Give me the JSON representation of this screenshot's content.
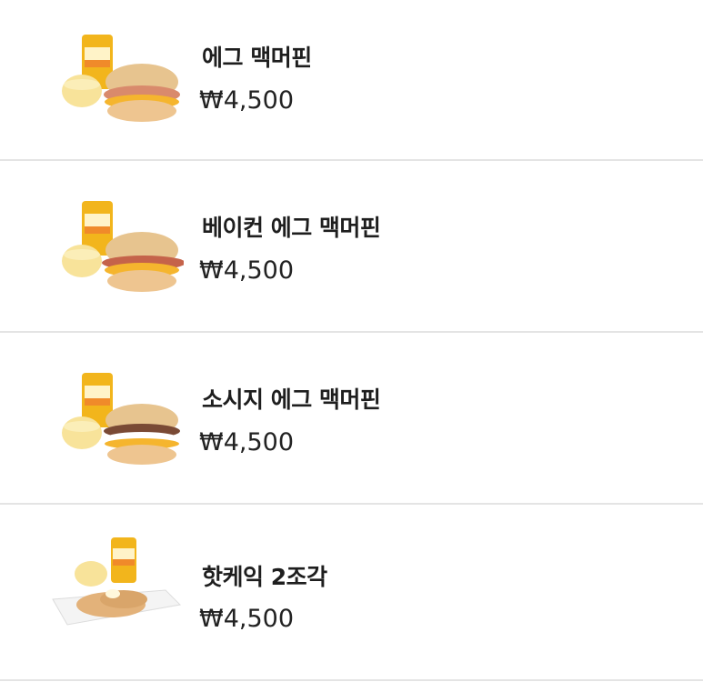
{
  "menu": {
    "items": [
      {
        "name": "에그 맥머핀",
        "price": "₩4,500",
        "image": "egg-mcmuffin-set-image"
      },
      {
        "name": "베이컨 에그 맥머핀",
        "price": "₩4,500",
        "image": "bacon-egg-mcmuffin-set-image"
      },
      {
        "name": "소시지 에그 맥머핀",
        "price": "₩4,500",
        "image": "sausage-egg-mcmuffin-set-image"
      },
      {
        "name": "핫케익 2조각",
        "price": "₩4,500",
        "image": "hotcakes-set-image"
      }
    ]
  },
  "colors": {
    "juice_can": "#f2b51c",
    "muffin": "#e7c48f",
    "cheese": "#f5b52e",
    "divider": "#e4e4e4"
  }
}
